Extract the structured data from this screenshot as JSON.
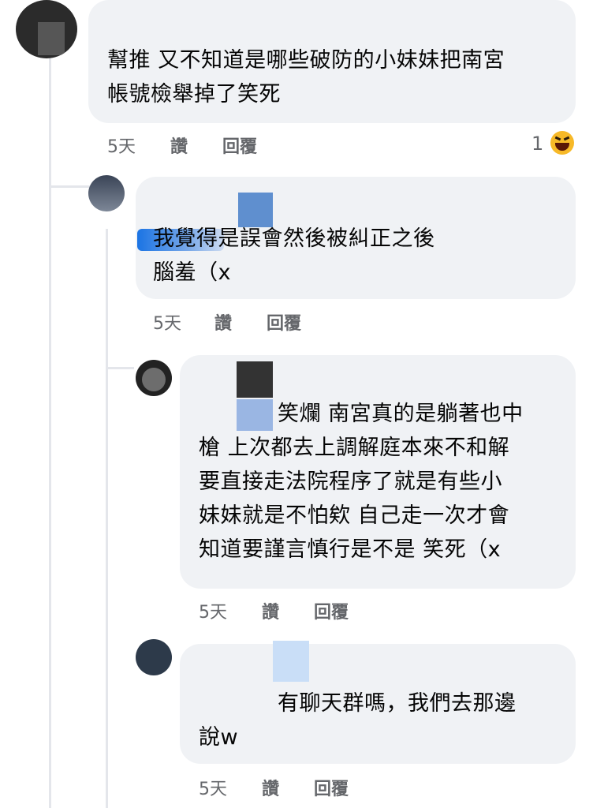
{
  "comments": [
    {
      "author": "",
      "text": "幫推 又不知道是哪些破防的小妹妹把南宮\n帳號檢舉掉了笑死",
      "time": "5天",
      "like": "讚",
      "reply": "回覆",
      "reaction_count": "1",
      "reaction_icon": "laugh-icon"
    },
    {
      "author": "",
      "mention": "",
      "text": "我覺得是誤會然後被糾正之後\n腦羞（x",
      "time": "5天",
      "like": "讚",
      "reply": "回覆"
    },
    {
      "author": "",
      "text": "笑爛 南宮真的是躺著也中\n槍 上次都去上調解庭本來不和解\n要直接走法院程序了就是有些小\n妹妹就是不怕欸 自己走一次才會\n知道要謹言慎行是不是 笑死（x",
      "time": "5天",
      "like": "讚",
      "reply": "回覆"
    },
    {
      "author": "",
      "text": "有聊天群嗎，我們去那邊\n說w",
      "time": "5天",
      "like": "讚",
      "reply": "回覆"
    }
  ],
  "colors": {
    "bubble": "#f0f2f5",
    "meta": "#65676b",
    "text": "#050505",
    "mention_blue": "#1b74e4"
  }
}
